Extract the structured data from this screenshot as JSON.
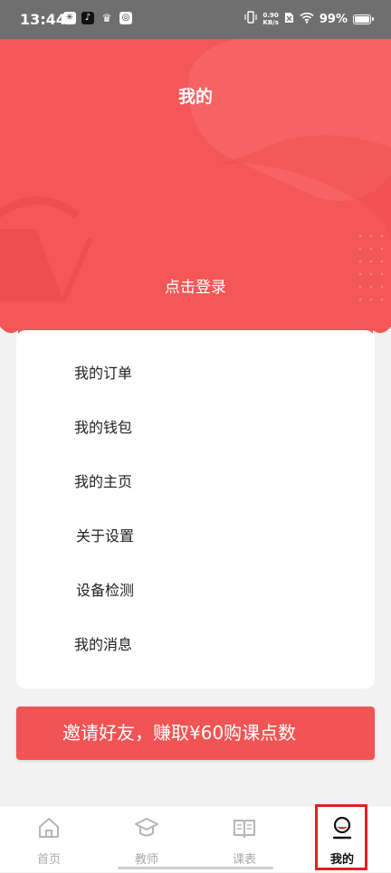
{
  "status_bar": {
    "time": "13:44",
    "app_icons": [
      "notification-app-icon",
      "tiktok-icon",
      "crown-icon",
      "swirl-app-icon"
    ],
    "net_speed_value": "0.90",
    "net_speed_unit": "KB/s",
    "battery": "99%"
  },
  "header": {
    "title": "我的",
    "login_prompt": "点击登录"
  },
  "menu": {
    "items": [
      {
        "label": "我的订单"
      },
      {
        "label": "我的钱包"
      },
      {
        "label": "我的主页"
      },
      {
        "label": "关于设置"
      },
      {
        "label": "设备检测"
      },
      {
        "label": "我的消息"
      }
    ]
  },
  "invite_banner": {
    "text": "邀请好友，赚取¥60购课点数"
  },
  "tabbar": {
    "tabs": [
      {
        "label": "首页",
        "icon": "home-icon"
      },
      {
        "label": "教师",
        "icon": "graduation-cap-icon"
      },
      {
        "label": "课表",
        "icon": "open-book-icon"
      },
      {
        "label": "我的",
        "icon": "profile-icon"
      }
    ],
    "active_index": 3
  },
  "colors": {
    "accent": "#f45757",
    "banner": "#f05454",
    "status_bar": "#6f6f6f",
    "highlight_box": "#e02020"
  }
}
